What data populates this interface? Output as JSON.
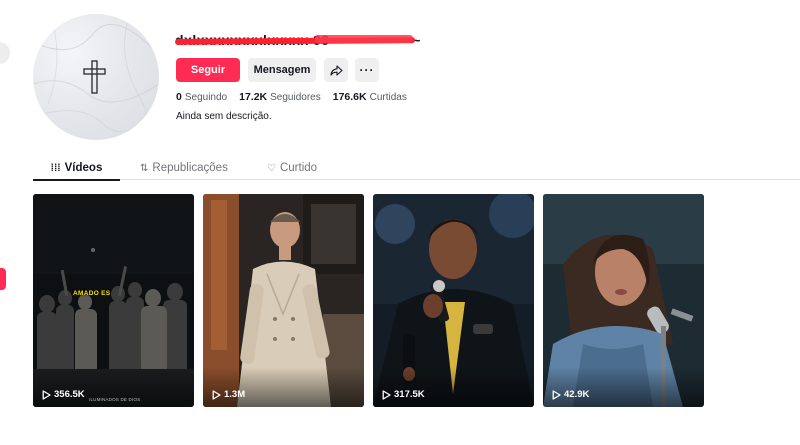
{
  "profile": {
    "username": "dxlxxxxxxxxlxxxxx 99 ~~~~~~~~~~",
    "follow_label": "Seguir",
    "message_label": "Mensagem",
    "share_icon": "share-icon",
    "more_icon": "more-icon",
    "more_label": "···",
    "avatar_icon": "cross-icon",
    "bio": "Ainda sem descrição.",
    "stats": [
      {
        "value": "0",
        "label": "Seguindo"
      },
      {
        "value": "17.2K",
        "label": "Seguidores"
      },
      {
        "value": "176.6K",
        "label": "Curtidas"
      }
    ]
  },
  "tabs": [
    {
      "label": "Vídeos",
      "icon": "grid-icon",
      "glyph": "⁞⁞⁞",
      "active": true
    },
    {
      "label": "Republicações",
      "icon": "repost-icon",
      "glyph": "⇅",
      "active": false
    },
    {
      "label": "Curtido",
      "icon": "heart-icon",
      "glyph": "♡",
      "active": false
    }
  ],
  "videos": [
    {
      "views": "356.5K",
      "caption": "AMADO ES",
      "watermark": "ILUMINADOS DE DIOS"
    },
    {
      "views": "1.3M"
    },
    {
      "views": "317.5K"
    },
    {
      "views": "42.9K"
    }
  ],
  "colors": {
    "accent": "#fe2c55",
    "text": "#161823",
    "muted": "#73757b",
    "button_bg": "#efefef"
  }
}
